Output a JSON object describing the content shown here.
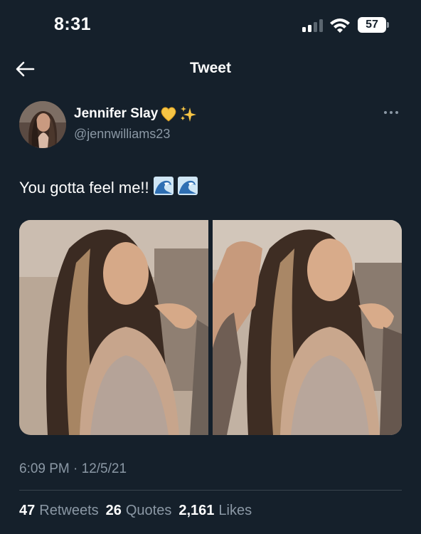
{
  "status_bar": {
    "time": "8:31",
    "battery_level": "57"
  },
  "header": {
    "title": "Tweet",
    "back_icon": "arrow-left-icon"
  },
  "tweet": {
    "author": {
      "name": "Jennifer Slay",
      "handle": "@jennwilliams23",
      "name_emojis": [
        "yellow-heart",
        "sparkles"
      ]
    },
    "text": "You gotta feel me!!",
    "text_emojis": [
      "water-wave",
      "water-wave"
    ],
    "media": [
      {
        "kind": "photo",
        "alt": ""
      },
      {
        "kind": "photo",
        "alt": ""
      }
    ],
    "timestamp": "6:09 PM · 12/5/21",
    "stats": {
      "retweets_count": "47",
      "retweets_label": "Retweets",
      "quotes_count": "26",
      "quotes_label": "Quotes",
      "likes_count": "2,161",
      "likes_label": "Likes"
    }
  },
  "colors": {
    "background": "#15202b",
    "text_primary": "#ffffff",
    "text_secondary": "#8b98a5",
    "divider": "#38444d"
  }
}
